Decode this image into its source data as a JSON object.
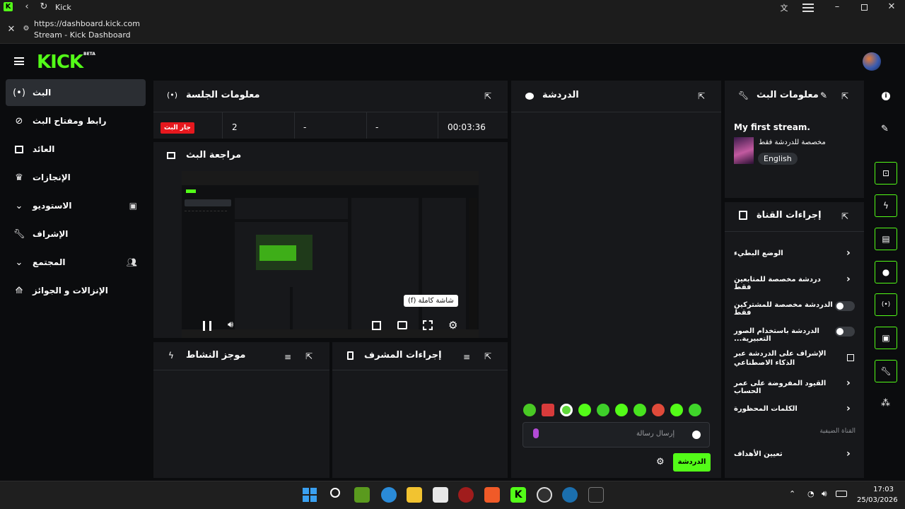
{
  "browser": {
    "tab_title": "Kick",
    "url": "https://dashboard.kick.com",
    "page_title": "Stream - Kick Dashboard"
  },
  "app": {
    "logo_text": "KICK",
    "logo_badge": "BETA",
    "accent_color": "#53fc18"
  },
  "sidebar": {
    "items": [
      {
        "label": "البث",
        "icon": "broadcast-icon",
        "active": true
      },
      {
        "label": "رابط ومفتاح البث",
        "icon": "link-icon"
      },
      {
        "label": "العائد",
        "icon": "revenue-icon"
      },
      {
        "label": "الإنجازات",
        "icon": "trophy-icon"
      },
      {
        "label": "الاستوديو",
        "icon": "chevron-down-icon",
        "extra_icon": "studio-icon"
      },
      {
        "label": "الإشراف",
        "icon": "wrench-icon"
      },
      {
        "label": "المجتمع",
        "icon": "chevron-down-icon",
        "extra_icon": "community-icon"
      },
      {
        "label": "الإنزالات و الجوائز",
        "icon": "drops-icon"
      }
    ]
  },
  "session": {
    "title": "معلومات الجلسة",
    "live_label": "جار البث",
    "viewers": "2",
    "stat2": "-",
    "stat3": "-",
    "duration": "00:03:36"
  },
  "preview": {
    "title": "مراجعة البث",
    "tooltip": "شاشة كاملة (f)"
  },
  "activity": {
    "title": "موجز النشاط"
  },
  "mod_actions": {
    "title": "إجراءات المشرف"
  },
  "chat": {
    "title": "الدردشة",
    "placeholder": "إرسال رسالة",
    "send_label": "الدردشة"
  },
  "stream_info": {
    "title": "معلومات البث",
    "stream_title": "My first stream.",
    "category": "مخصصة للدردشة فقط",
    "language": "English"
  },
  "channel_actions": {
    "title": "إجراءات القناة",
    "rows": [
      {
        "label": "الوضع البطيء",
        "control": "chevron"
      },
      {
        "label": "دردشة مخصصة للمتابعين فقط",
        "control": "chevron"
      },
      {
        "label": "الدردشة مخصصة للمشتركين فقط",
        "control": "toggle",
        "on": false
      },
      {
        "label": "الدردشة باستخدام الصور التعبيرية...",
        "control": "toggle",
        "on": false
      },
      {
        "label": "الإشراف على الدردشة عبر الذكاء الاصطناعي",
        "control": "external"
      },
      {
        "label": "القيود المفروضة على عمر الحساب",
        "control": "chevron"
      },
      {
        "label": "الكلمات المحظورة",
        "control": "chevron"
      }
    ],
    "section_label": "القناة الضيفية",
    "goals_label": "تعيين الأهداف"
  },
  "taskbar": {
    "time": "17:03",
    "date": "25/03/2026"
  }
}
